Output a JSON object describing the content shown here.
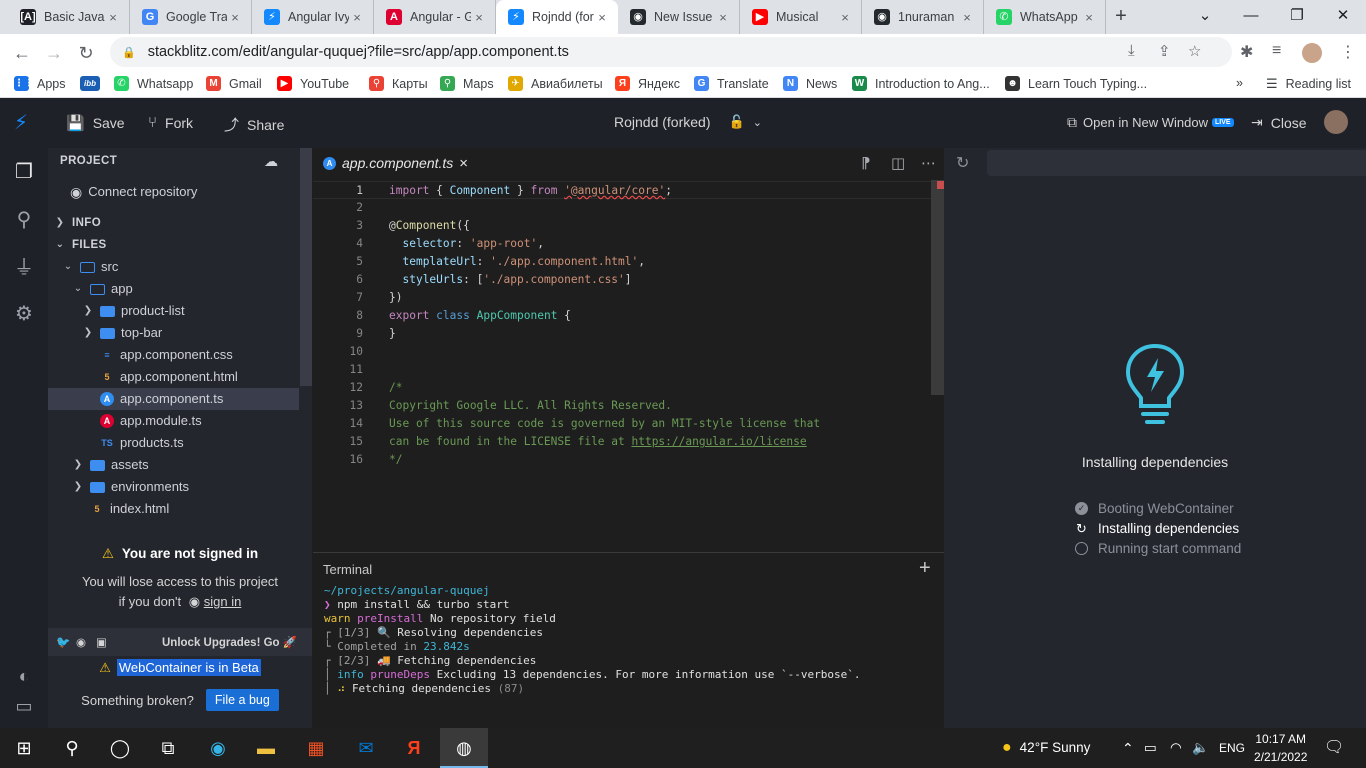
{
  "browser": {
    "tabs": [
      {
        "label": "Basic JavaScr",
        "icon": "[A]",
        "color": "#1f2129"
      },
      {
        "label": "Google Trans",
        "icon": "G",
        "color": "#4285f4"
      },
      {
        "label": "Angular Ivy",
        "icon": "⚡",
        "color": "#1389fd"
      },
      {
        "label": "Angular - Ge",
        "icon": "A",
        "color": "#dd0031"
      },
      {
        "label": "Rojndd (fork",
        "icon": "⚡",
        "color": "#1389fd",
        "active": true
      },
      {
        "label": "New Issue",
        "icon": "◉",
        "color": "#24292e"
      },
      {
        "label": "Musical",
        "icon": "▶",
        "color": "#ff0000"
      },
      {
        "label": "1nuraman",
        "icon": "◉",
        "color": "#24292e"
      },
      {
        "label": "WhatsApp",
        "icon": "✆",
        "color": "#25d366"
      }
    ],
    "tab_close": "×",
    "new_tab": "+",
    "url": "stackblitz.com/edit/angular-ququej?file=src/app/app.component.ts",
    "bookmarks": [
      {
        "label": "Apps",
        "icon": "⋮⋮",
        "color": "#1a73e8"
      },
      {
        "label": "",
        "icon": "ibb",
        "color": "#1b5fb4"
      },
      {
        "label": "Whatsapp",
        "icon": "✆",
        "color": "#25d366"
      },
      {
        "label": "Gmail",
        "icon": "M",
        "color": "#ea4335"
      },
      {
        "label": "YouTube",
        "icon": "▶",
        "color": "#ff0000"
      },
      {
        "label": "Карты",
        "icon": "⚲",
        "color": "#ea4335"
      },
      {
        "label": "Maps",
        "icon": "⚲",
        "color": "#34a853"
      },
      {
        "label": "Авиабилеты",
        "icon": "✈",
        "color": "#e0a800"
      },
      {
        "label": "Яндекс",
        "icon": "Я",
        "color": "#fc3f1d"
      },
      {
        "label": "Translate",
        "icon": "G",
        "color": "#4285f4"
      },
      {
        "label": "News",
        "icon": "N",
        "color": "#4285f4"
      },
      {
        "label": "Introduction to Ang...",
        "icon": "W",
        "color": "#1a8a4a"
      },
      {
        "label": "Learn Touch Typing...",
        "icon": "☻",
        "color": "#333333"
      }
    ],
    "bookmarks_more": "»",
    "reading_list": "Reading list"
  },
  "stackblitz": {
    "save": "Save",
    "fork": "Fork",
    "share": "Share",
    "project_title": "Rojndd (forked)",
    "open_new_window": "Open in New Window",
    "live_badge": "LIVE",
    "close": "Close"
  },
  "sidebar": {
    "project_header": "PROJECT",
    "connect_repo": "Connect repository",
    "info_header": "INFO",
    "files_header": "FILES",
    "tree": [
      {
        "name": "src",
        "depth": 0,
        "type": "folder-open"
      },
      {
        "name": "app",
        "depth": 1,
        "type": "folder-open"
      },
      {
        "name": "product-list",
        "depth": 2,
        "type": "folder"
      },
      {
        "name": "top-bar",
        "depth": 2,
        "type": "folder"
      },
      {
        "name": "app.component.css",
        "depth": 2,
        "type": "css"
      },
      {
        "name": "app.component.html",
        "depth": 2,
        "type": "html"
      },
      {
        "name": "app.component.ts",
        "depth": 2,
        "type": "ngts",
        "selected": true
      },
      {
        "name": "app.module.ts",
        "depth": 2,
        "type": "ngmod"
      },
      {
        "name": "products.ts",
        "depth": 2,
        "type": "ts"
      },
      {
        "name": "assets",
        "depth": 1,
        "type": "folder"
      },
      {
        "name": "environments",
        "depth": 1,
        "type": "folder"
      },
      {
        "name": "index.html",
        "depth": 1,
        "type": "html"
      }
    ],
    "not_signed_title": "You are not signed in",
    "lose_access": "You will lose access to this project",
    "if_you_dont": "if you don't",
    "sign_in": "sign in",
    "unlock": "Unlock Upgrades! Go",
    "beta_text": "WebContainer is in Beta",
    "something_broken": "Something broken?",
    "file_bug": "File a bug"
  },
  "editor": {
    "tab_label": "app.component.ts",
    "tab_close": "×",
    "code_lines": [
      {
        "n": "1",
        "parts": [
          [
            "kw2",
            "import"
          ],
          [
            "",
            " { "
          ],
          [
            "pr",
            "Component"
          ],
          [
            "",
            " } "
          ],
          [
            "kw2",
            "from"
          ],
          [
            "",
            " "
          ],
          [
            "st squig",
            "'@angular/core'"
          ],
          [
            "",
            ";"
          ]
        ]
      },
      {
        "n": "2",
        "parts": []
      },
      {
        "n": "3",
        "parts": [
          [
            "",
            "@"
          ],
          [
            "fn",
            "Component"
          ],
          [
            "",
            "({"
          ]
        ]
      },
      {
        "n": "4",
        "parts": [
          [
            "",
            "  "
          ],
          [
            "pr",
            "selector"
          ],
          [
            "",
            ": "
          ],
          [
            "st",
            "'app-root'"
          ],
          [
            "",
            ","
          ]
        ]
      },
      {
        "n": "5",
        "parts": [
          [
            "",
            "  "
          ],
          [
            "pr",
            "templateUrl"
          ],
          [
            "",
            ": "
          ],
          [
            "st",
            "'./app.component.html'"
          ],
          [
            "",
            ","
          ]
        ]
      },
      {
        "n": "6",
        "parts": [
          [
            "",
            "  "
          ],
          [
            "pr",
            "styleUrls"
          ],
          [
            "",
            ": ["
          ],
          [
            "st",
            "'./app.component.css'"
          ],
          [
            "",
            "]"
          ]
        ]
      },
      {
        "n": "7",
        "parts": [
          [
            "",
            "})"
          ]
        ]
      },
      {
        "n": "8",
        "parts": [
          [
            "kw2",
            "export"
          ],
          [
            "",
            " "
          ],
          [
            "kw",
            "class"
          ],
          [
            "",
            " "
          ],
          [
            "ty",
            "AppComponent"
          ],
          [
            "",
            " {"
          ]
        ]
      },
      {
        "n": "9",
        "parts": [
          [
            "",
            "}"
          ]
        ]
      },
      {
        "n": "10",
        "parts": []
      },
      {
        "n": "11",
        "parts": []
      },
      {
        "n": "12",
        "parts": [
          [
            "cm",
            "/*"
          ]
        ]
      },
      {
        "n": "13",
        "parts": [
          [
            "cm",
            "Copyright Google LLC. All Rights Reserved."
          ]
        ]
      },
      {
        "n": "14",
        "parts": [
          [
            "cm",
            "Use of this source code is governed by an MIT-style license that"
          ]
        ]
      },
      {
        "n": "15",
        "parts": [
          [
            "cm",
            "can be found in the LICENSE file at "
          ],
          [
            "cm link",
            "https://angular.io/license"
          ]
        ]
      },
      {
        "n": "16",
        "parts": [
          [
            "cm",
            "*/"
          ]
        ]
      }
    ]
  },
  "terminal": {
    "title": "Terminal",
    "plus": "+",
    "lines": [
      [
        [
          "tcyan",
          "~/projects/angular-ququej"
        ]
      ],
      [
        [
          "tmag",
          "❯ "
        ],
        [
          "",
          "npm install && turbo start"
        ]
      ],
      [
        [
          "tyel",
          "warn "
        ],
        [
          "tmag",
          "preInstall "
        ],
        [
          "",
          "No repository field"
        ]
      ],
      [
        [
          "tgray",
          "┌ [1/3] "
        ],
        [
          "",
          "🔍 Resolving dependencies"
        ]
      ],
      [
        [
          "tgray",
          "└ Completed in "
        ],
        [
          "tcyan",
          "23.842s"
        ]
      ],
      [
        [
          "tgray",
          "┌ [2/3] "
        ],
        [
          "",
          "🚚 Fetching dependencies"
        ]
      ],
      [
        [
          "tgray",
          "│ "
        ],
        [
          "tcyan",
          "info "
        ],
        [
          "tmag",
          "pruneDeps "
        ],
        [
          "",
          "Excluding 13 dependencies. For more information use `--verbose`."
        ]
      ],
      [
        [
          "tgray",
          "│ "
        ],
        [
          "tyel",
          "⠴ "
        ],
        [
          "",
          "Fetching dependencies "
        ],
        [
          "tdim",
          "(87)"
        ]
      ]
    ]
  },
  "preview": {
    "status_title": "Installing dependencies",
    "steps": [
      {
        "label": "Booting WebContainer",
        "state": "done",
        "icon": "✓"
      },
      {
        "label": "Installing dependencies",
        "state": "active",
        "icon": "↻"
      },
      {
        "label": "Running start command",
        "state": "pending",
        "icon": ""
      }
    ]
  },
  "taskbar": {
    "weather": "42°F  Sunny",
    "lang": "ENG",
    "time": "10:17 AM",
    "date": "2/21/2022"
  },
  "colors": {
    "accent": "#1389fd",
    "bulb": "#3fc1e0"
  }
}
